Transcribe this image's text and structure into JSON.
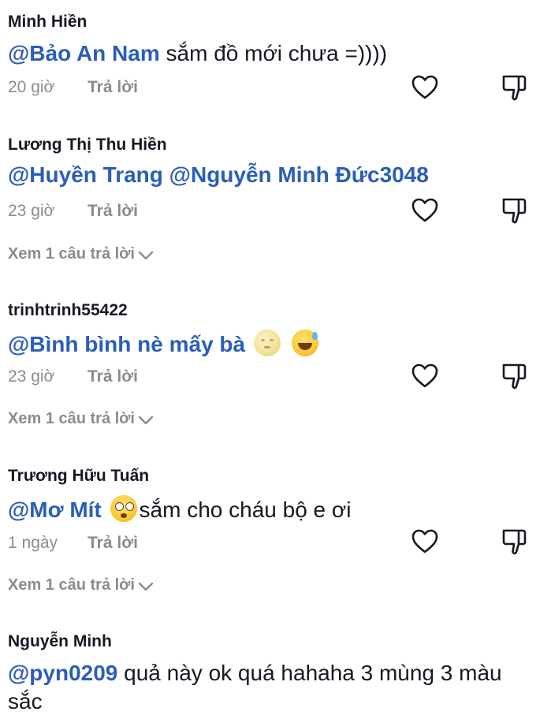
{
  "comments": [
    {
      "username": "Minh Hiền",
      "mention": "@Bảo An Nam",
      "text": " sắm đồ mới chưa =))))",
      "time": "20 giờ",
      "reply_label": "Trả lời"
    },
    {
      "username": "Lương Thị Thu Hiền",
      "mention": "@Huyền Trang @Nguyễn Minh Đức3048",
      "text": "",
      "time": "23 giờ",
      "reply_label": "Trả lời",
      "view_replies": "Xem 1 câu trả lời"
    },
    {
      "username": "trinhtrinh55422",
      "mention": "@Bình bình nè mấy bà",
      "text": "",
      "emojis": [
        "full-moon-face",
        "grinning-sweat"
      ],
      "time": "23 giờ",
      "reply_label": "Trả lời",
      "view_replies": "Xem 1 câu trả lời"
    },
    {
      "username": "Trương Hữu Tuấn",
      "mention": "@Mơ Mít",
      "emojis": [
        "flushed-face"
      ],
      "text": "sắm cho cháu bộ e ơi",
      "time": "1 ngày",
      "reply_label": "Trả lời",
      "view_replies": "Xem 1 câu trả lời"
    },
    {
      "username": "Nguyễn Minh",
      "mention": "@pyn0209",
      "text": " quả này ok quá hahaha 3 mùng 3 màu sắc"
    }
  ],
  "icons": {
    "like": "heart-outline-icon",
    "dislike": "thumbs-down-icon",
    "expand": "chevron-down-icon"
  },
  "colors": {
    "mention": "#2b5db9",
    "meta": "#8a8b91",
    "text": "#161823"
  }
}
